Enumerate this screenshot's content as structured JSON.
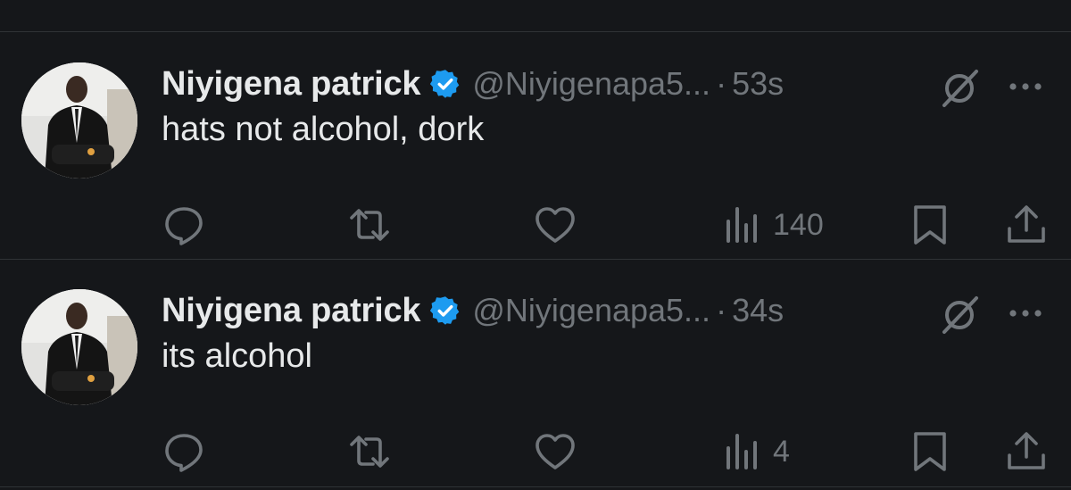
{
  "tweets": [
    {
      "author_name": "Niyigena patrick",
      "handle": "@Niyigenapa5...",
      "separator": "·",
      "time": "53s",
      "text": "hats not alcohol, dork",
      "views": "140"
    },
    {
      "author_name": "Niyigena patrick",
      "handle": "@Niyigenapa5...",
      "separator": "·",
      "time": "34s",
      "text": "its alcohol",
      "views": "4"
    }
  ],
  "icons": {
    "verified": "verified-badge-icon",
    "grok": "grok-icon",
    "more": "more-icon",
    "reply": "reply-icon",
    "retweet": "retweet-icon",
    "like": "like-icon",
    "views": "views-icon",
    "bookmark": "bookmark-icon",
    "share": "share-icon"
  },
  "colors": {
    "background": "#15171a",
    "text": "#e7e9ea",
    "secondary": "#71767b",
    "verified": "#1d9bf0",
    "divider": "#2f3336"
  }
}
